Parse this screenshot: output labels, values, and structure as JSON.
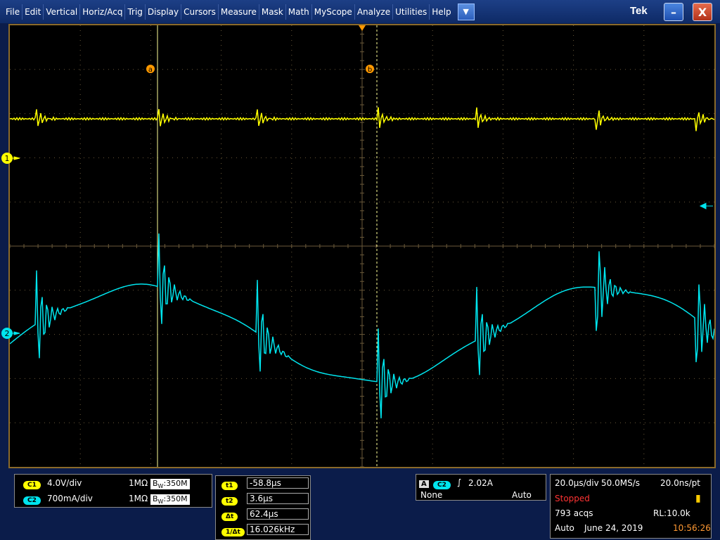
{
  "menu": {
    "items": [
      "File",
      "Edit",
      "Vertical",
      "Horiz/Acq",
      "Trig",
      "Display",
      "Cursors",
      "Measure",
      "Mask",
      "Math",
      "MyScope",
      "Analyze",
      "Utilities",
      "Help"
    ],
    "dropdown_icon": "triangle-down-icon"
  },
  "brand": "Tek",
  "window": {
    "minimize": "–",
    "close": "X"
  },
  "markers": {
    "ch1": "1",
    "ch2": "2",
    "cursor_a": "a",
    "cursor_b": "b"
  },
  "colors": {
    "ch1": "#ffff00",
    "ch2": "#00e5ee",
    "cursor": "#ff9900",
    "grid": "#6b5a3a"
  },
  "channels": [
    {
      "badge": "C1",
      "scale": "4.0V/div",
      "impedance": "1MΩ",
      "bw_prefix": "B",
      "bw_sub": "W",
      "bandwidth": ":350M"
    },
    {
      "badge": "C2",
      "scale": "700mA/div",
      "impedance": "1MΩ",
      "bw_prefix": "B",
      "bw_sub": "W",
      "bandwidth": ":350M"
    }
  ],
  "cursors": [
    {
      "label": "t1",
      "value": "-58.8µs"
    },
    {
      "label": "t2",
      "value": "3.6µs"
    },
    {
      "label": "Δt",
      "value": "62.4µs"
    },
    {
      "label": "1/Δt",
      "value": "16.026kHz"
    }
  ],
  "trigger": {
    "mode_letter": "A",
    "source": "C2",
    "level": "2.02A",
    "coupling": "None",
    "mode": "Auto"
  },
  "acquisition": {
    "horiz_scale": "20.0µs/div",
    "sample_rate": "50.0MS/s",
    "resolution": "20.0ns/pt",
    "state": "Stopped",
    "acqs": "793 acqs",
    "record_length": "RL:10.0k",
    "run_mode": "Auto",
    "date": "June 24, 2019",
    "time": "10:56:26"
  }
}
